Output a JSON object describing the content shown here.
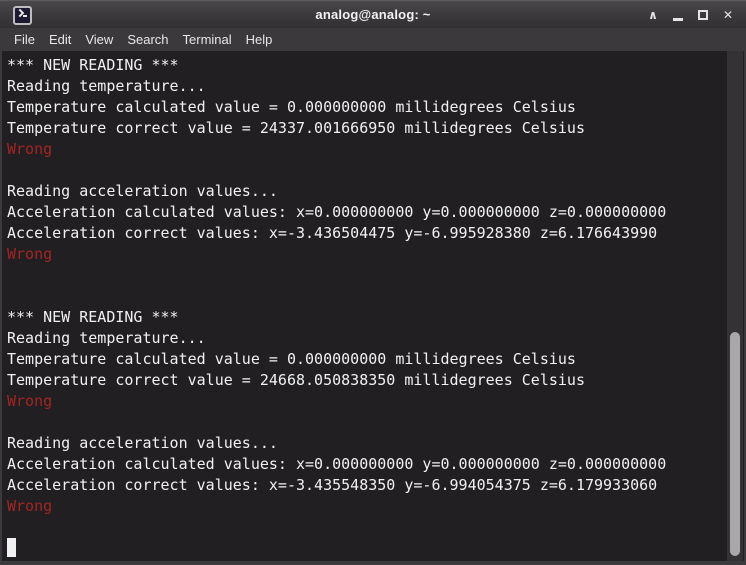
{
  "window": {
    "title": "analog@analog: ~",
    "controls": {
      "shade_glyph": "∧",
      "close_glyph": "✕"
    }
  },
  "menu": {
    "items": [
      "File",
      "Edit",
      "View",
      "Search",
      "Terminal",
      "Help"
    ]
  },
  "terminal": {
    "lines": [
      {
        "text": "*** NEW READING ***",
        "color": "fg"
      },
      {
        "text": "Reading temperature...",
        "color": "fg"
      },
      {
        "text": "Temperature calculated value = 0.000000000 millidegrees Celsius",
        "color": "fg"
      },
      {
        "text": "Temperature correct value = 24337.001666950 millidegrees Celsius",
        "color": "fg"
      },
      {
        "text": "Wrong",
        "color": "red"
      },
      {
        "text": "",
        "color": "fg"
      },
      {
        "text": "Reading acceleration values...",
        "color": "fg"
      },
      {
        "text": "Acceleration calculated values: x=0.000000000 y=0.000000000 z=0.000000000",
        "color": "fg"
      },
      {
        "text": "Acceleration correct values: x=-3.436504475 y=-6.995928380 z=6.176643990",
        "color": "fg"
      },
      {
        "text": "Wrong",
        "color": "red"
      },
      {
        "text": "",
        "color": "fg"
      },
      {
        "text": "",
        "color": "fg"
      },
      {
        "text": "*** NEW READING ***",
        "color": "fg"
      },
      {
        "text": "Reading temperature...",
        "color": "fg"
      },
      {
        "text": "Temperature calculated value = 0.000000000 millidegrees Celsius",
        "color": "fg"
      },
      {
        "text": "Temperature correct value = 24668.050838350 millidegrees Celsius",
        "color": "fg"
      },
      {
        "text": "Wrong",
        "color": "red"
      },
      {
        "text": "",
        "color": "fg"
      },
      {
        "text": "Reading acceleration values...",
        "color": "fg"
      },
      {
        "text": "Acceleration calculated values: x=0.000000000 y=0.000000000 z=0.000000000",
        "color": "fg"
      },
      {
        "text": "Acceleration correct values: x=-3.435548350 y=-6.994054375 z=6.179933060",
        "color": "fg"
      },
      {
        "text": "Wrong",
        "color": "red"
      },
      {
        "text": "",
        "color": "fg"
      },
      {
        "text": "",
        "color": "fg",
        "cursor": true
      }
    ]
  },
  "colors": {
    "terminal_background": "#211f22",
    "terminal_foreground": "#f1f1f1",
    "error_red": "#a32522",
    "titlebar_gray": "#3d3b3d",
    "scrollbar_thumb": "#a8a8a8"
  }
}
